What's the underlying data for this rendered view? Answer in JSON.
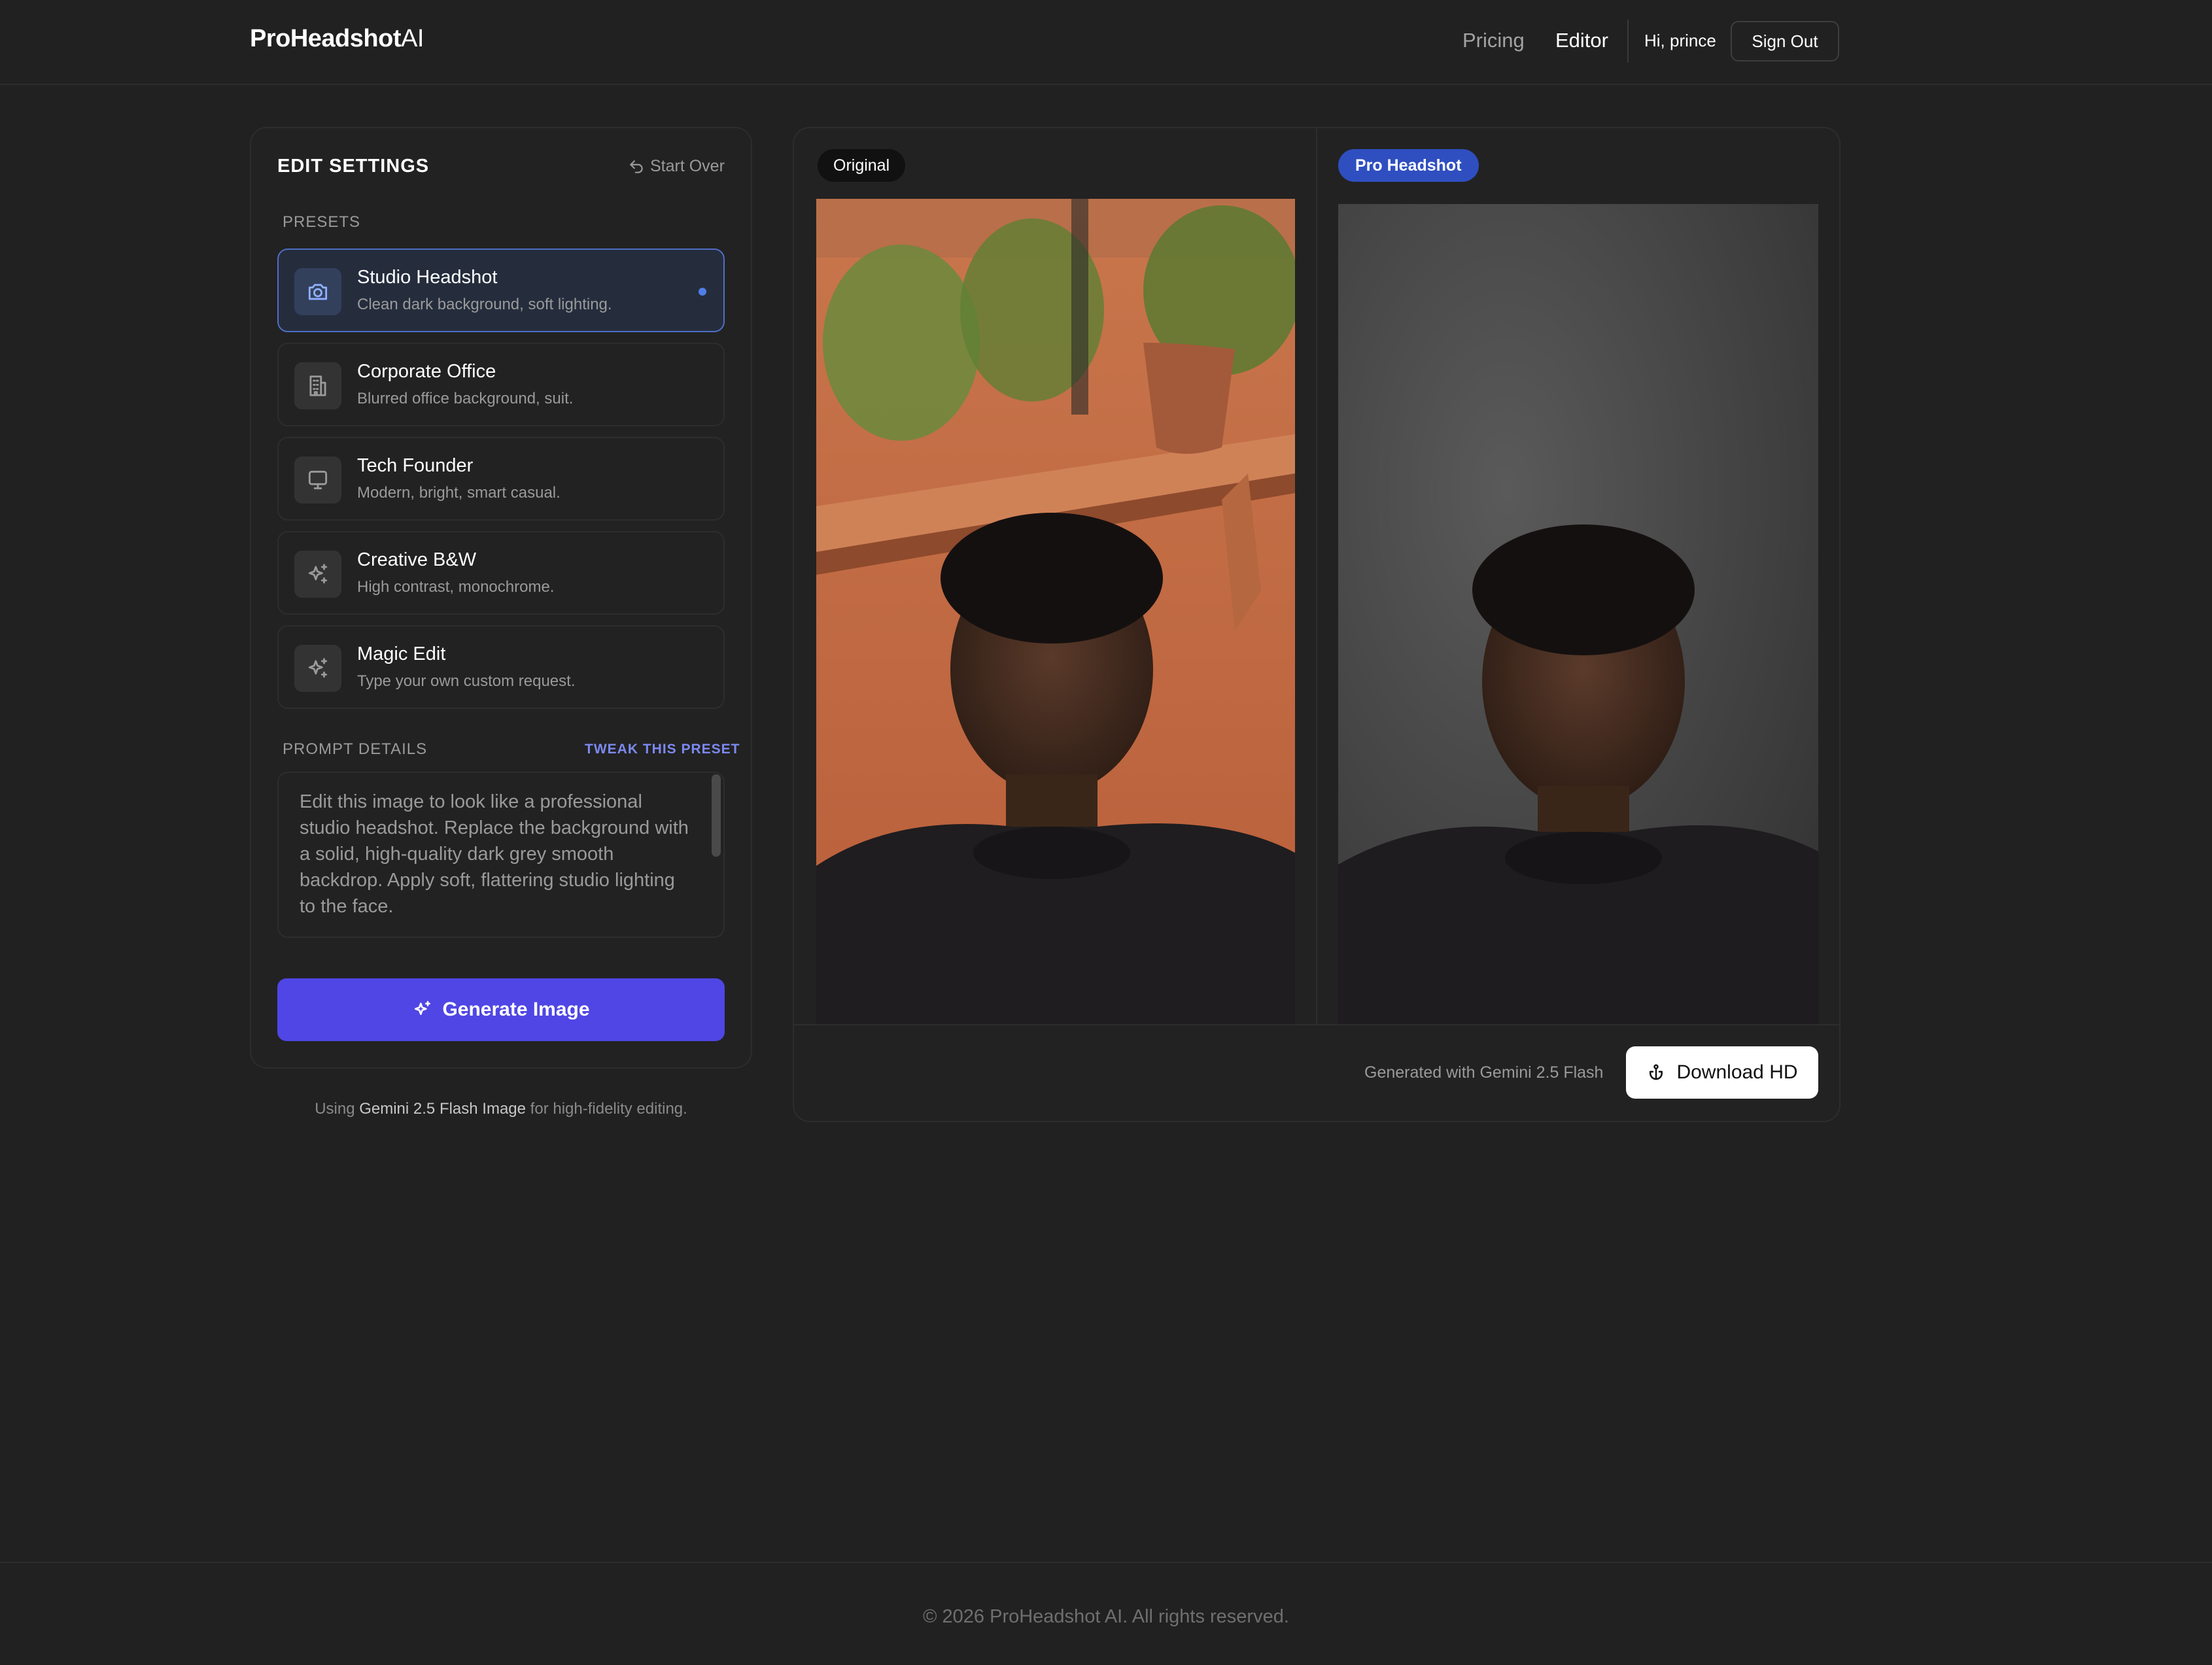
{
  "header": {
    "logo_bold": "ProHeadshot",
    "logo_light": "AI",
    "nav": {
      "pricing": "Pricing",
      "editor": "Editor"
    },
    "greeting": "Hi, prince",
    "sign_out": "Sign Out"
  },
  "settings": {
    "title": "EDIT SETTINGS",
    "start_over": "Start Over",
    "presets_label": "PRESETS",
    "presets": [
      {
        "title": "Studio Headshot",
        "desc": "Clean dark background, soft lighting.",
        "icon": "camera-icon",
        "active": true
      },
      {
        "title": "Corporate Office",
        "desc": "Blurred office background, suit.",
        "icon": "building-icon",
        "active": false
      },
      {
        "title": "Tech Founder",
        "desc": "Modern, bright, smart casual.",
        "icon": "monitor-icon",
        "active": false
      },
      {
        "title": "Creative B&W",
        "desc": "High contrast, monochrome.",
        "icon": "sparkles-icon",
        "active": false
      },
      {
        "title": "Magic Edit",
        "desc": "Type your own custom request.",
        "icon": "sparkles-icon",
        "active": false
      }
    ],
    "prompt_label": "PROMPT DETAILS",
    "tweak_label": "TWEAK THIS PRESET",
    "prompt_text": "Edit this image to look like a professional studio headshot. Replace the background with a solid, high-quality dark grey smooth backdrop. Apply soft, flattering studio lighting to the face.",
    "generate_label": "Generate Image",
    "using_prefix": "Using",
    "using_model": "Gemini 2.5 Flash Image",
    "using_suffix": "for high-fidelity editing."
  },
  "preview": {
    "original_badge": "Original",
    "result_badge": "Pro Headshot",
    "generated_with": "Generated with Gemini 2.5 Flash",
    "download_label": "Download HD"
  },
  "footer": {
    "copyright": "© 2026 ProHeadshot AI. All rights reserved."
  },
  "colors": {
    "background": "#212121",
    "accent": "#4f46e5",
    "active_border": "#4f6fc6",
    "badge_pro": "#2f4fc0",
    "tweak_link": "#7c89f2"
  }
}
